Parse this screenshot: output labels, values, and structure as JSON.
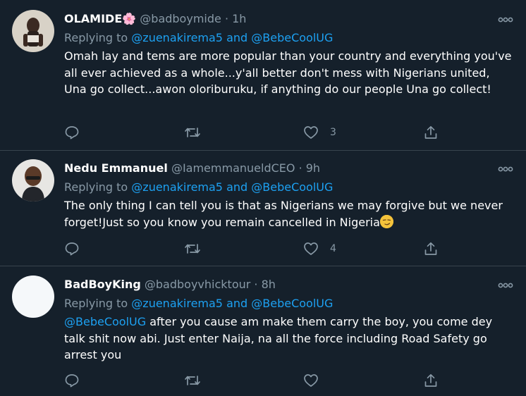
{
  "tweets": [
    {
      "name": "OLAMIDE🌸",
      "handle": "@badboymide",
      "time": "· 1h",
      "replying_prefix": "Replying to ",
      "mention1": "@zuenakirema5",
      "and": " and ",
      "mention2": "@BebeCoolUG",
      "text": "Omah lay and tems are more popular than your country and everything you've all ever achieved as a whole...y'all better don't mess with Nigerians united, Una go collect...awon oloriburuku, if anything do our people Una go collect!",
      "likes": "3"
    },
    {
      "name": "Nedu Emmanuel",
      "handle": "@IamemmanueldCEO",
      "time": "· 9h",
      "replying_prefix": "Replying to ",
      "mention1": "@zuenakirema5",
      "and": " and ",
      "mention2": "@BebeCoolUG",
      "text": "The only thing I can tell you is that as Nigerians we may forgive but we never forget!Just so you know you remain cancelled in Nigeria",
      "likes": "4"
    },
    {
      "name": "BadBoyKing",
      "handle": "@badboyvhicktour",
      "time": "· 8h",
      "replying_prefix": "Replying to ",
      "mention1": "@zuenakirema5",
      "and": " and ",
      "mention2": "@BebeCoolUG",
      "text_mention": "@BebeCoolUG",
      "text": " after you cause am make them carry the boy, you come dey talk shit now abi. Just enter Naija, na all the force including Road Safety go arrest you",
      "likes": ""
    }
  ],
  "colors": {
    "background": "#15202b",
    "link": "#1da1f2",
    "muted": "#8899a6",
    "divider": "#38444d"
  },
  "icons": [
    "more-icon",
    "reply-icon",
    "retweet-icon",
    "like-icon",
    "share-icon",
    "smirk-emoji"
  ]
}
